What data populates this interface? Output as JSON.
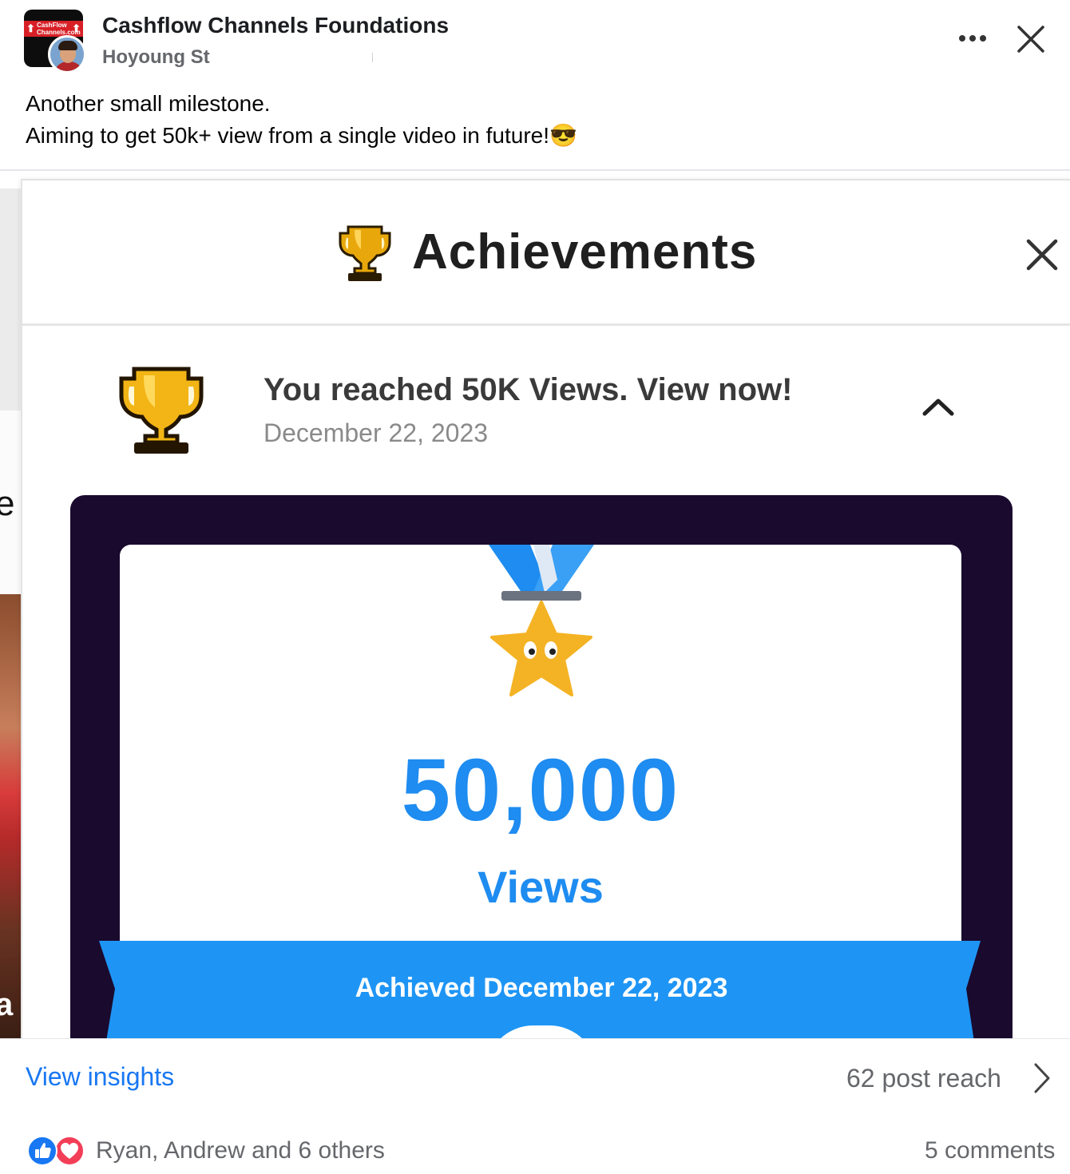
{
  "post": {
    "group_name": "Cashflow Channels Foundations",
    "author": "Hoyoung St",
    "group_logo_text": "CashFlow Channels.com",
    "text_lines": [
      "Another small milestone.",
      "Aiming to get 50k+ view from a single video in future!😎"
    ]
  },
  "achievement_screenshot": {
    "title": "Achievements",
    "notification_title": "You reached 50K Views. View now!",
    "notification_date": "December 22, 2023",
    "views_number": "50,000",
    "views_label": "Views",
    "ribbon_text": "Achieved December 22, 2023",
    "side_letters": [
      "e",
      "a"
    ]
  },
  "footer": {
    "insights_label": "View insights",
    "post_reach": "62 post reach",
    "reaction_names": "Ryan, Andrew and 6 others",
    "comments": "5 comments"
  },
  "icons": {
    "more": "more-options-icon",
    "close": "close-icon",
    "trophy": "trophy-icon",
    "chevron_up": "chevron-up-icon",
    "chevron_right": "chevron-right-icon",
    "like": "like-icon",
    "love": "love-icon"
  },
  "colors": {
    "link_blue": "#1877f2",
    "views_blue": "#1e8cf0",
    "card_frame": "#1a0a2e",
    "love_red": "#f33e58"
  }
}
